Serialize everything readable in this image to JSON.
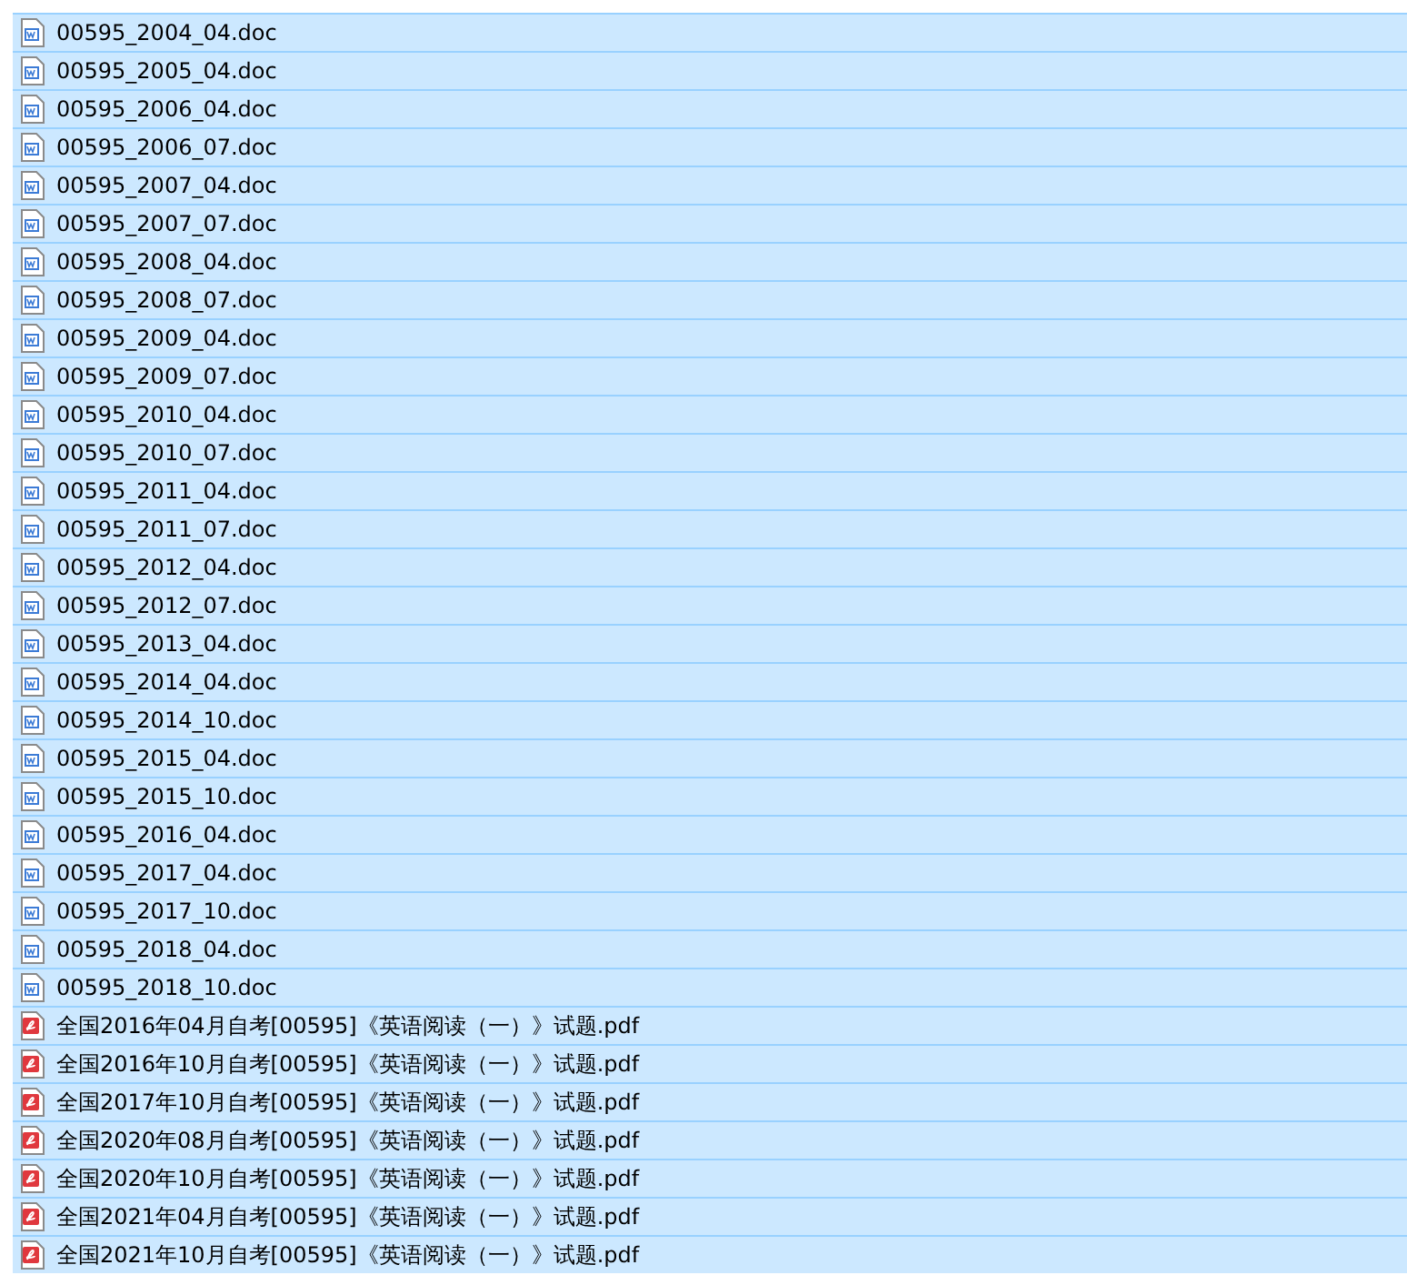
{
  "files": [
    {
      "name": "00595_2004_04.doc",
      "kind": "doc",
      "selected": true
    },
    {
      "name": "00595_2005_04.doc",
      "kind": "doc",
      "selected": true
    },
    {
      "name": "00595_2006_04.doc",
      "kind": "doc",
      "selected": true
    },
    {
      "name": "00595_2006_07.doc",
      "kind": "doc",
      "selected": true
    },
    {
      "name": "00595_2007_04.doc",
      "kind": "doc",
      "selected": true
    },
    {
      "name": "00595_2007_07.doc",
      "kind": "doc",
      "selected": true
    },
    {
      "name": "00595_2008_04.doc",
      "kind": "doc",
      "selected": true
    },
    {
      "name": "00595_2008_07.doc",
      "kind": "doc",
      "selected": true
    },
    {
      "name": "00595_2009_04.doc",
      "kind": "doc",
      "selected": true
    },
    {
      "name": "00595_2009_07.doc",
      "kind": "doc",
      "selected": true
    },
    {
      "name": "00595_2010_04.doc",
      "kind": "doc",
      "selected": true
    },
    {
      "name": "00595_2010_07.doc",
      "kind": "doc",
      "selected": true
    },
    {
      "name": "00595_2011_04.doc",
      "kind": "doc",
      "selected": true
    },
    {
      "name": "00595_2011_07.doc",
      "kind": "doc",
      "selected": true
    },
    {
      "name": "00595_2012_04.doc",
      "kind": "doc",
      "selected": true
    },
    {
      "name": "00595_2012_07.doc",
      "kind": "doc",
      "selected": true
    },
    {
      "name": "00595_2013_04.doc",
      "kind": "doc",
      "selected": true
    },
    {
      "name": "00595_2014_04.doc",
      "kind": "doc",
      "selected": true
    },
    {
      "name": "00595_2014_10.doc",
      "kind": "doc",
      "selected": true
    },
    {
      "name": "00595_2015_04.doc",
      "kind": "doc",
      "selected": true
    },
    {
      "name": "00595_2015_10.doc",
      "kind": "doc",
      "selected": true
    },
    {
      "name": "00595_2016_04.doc",
      "kind": "doc",
      "selected": true
    },
    {
      "name": "00595_2017_04.doc",
      "kind": "doc",
      "selected": true
    },
    {
      "name": "00595_2017_10.doc",
      "kind": "doc",
      "selected": true
    },
    {
      "name": "00595_2018_04.doc",
      "kind": "doc",
      "selected": true
    },
    {
      "name": "00595_2018_10.doc",
      "kind": "doc",
      "selected": true
    },
    {
      "name": "全国2016年04月自考[00595]《英语阅读（一）》试题.pdf",
      "kind": "pdf",
      "selected": true
    },
    {
      "name": "全国2016年10月自考[00595]《英语阅读（一）》试题.pdf",
      "kind": "pdf",
      "selected": true
    },
    {
      "name": "全国2017年10月自考[00595]《英语阅读（一）》试题.pdf",
      "kind": "pdf",
      "selected": true
    },
    {
      "name": "全国2020年08月自考[00595]《英语阅读（一）》试题.pdf",
      "kind": "pdf",
      "selected": true
    },
    {
      "name": "全国2020年10月自考[00595]《英语阅读（一）》试题.pdf",
      "kind": "pdf",
      "selected": true
    },
    {
      "name": "全国2021年04月自考[00595]《英语阅读（一）》试题.pdf",
      "kind": "pdf",
      "selected": true
    },
    {
      "name": "全国2021年10月自考[00595]《英语阅读（一）》试题.pdf",
      "kind": "pdf",
      "selected": true
    }
  ]
}
